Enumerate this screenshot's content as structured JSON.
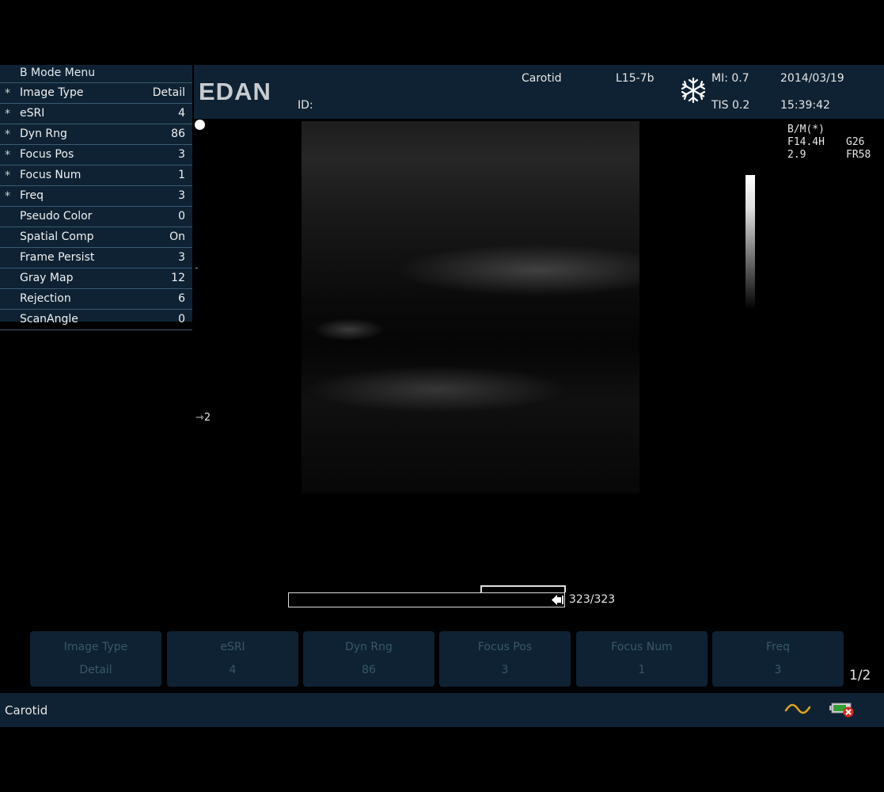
{
  "menu": {
    "title": "B Mode Menu",
    "items": [
      {
        "star": "*",
        "label": "Image Type",
        "value": "Detail"
      },
      {
        "star": "*",
        "label": "eSRI",
        "value": "4"
      },
      {
        "star": "*",
        "label": "Dyn Rng",
        "value": "86"
      },
      {
        "star": "*",
        "label": "Focus Pos",
        "value": "3"
      },
      {
        "star": "*",
        "label": "Focus Num",
        "value": "1"
      },
      {
        "star": "*",
        "label": "Freq",
        "value": "3"
      },
      {
        "star": "",
        "label": "Pseudo Color",
        "value": "0"
      },
      {
        "star": "",
        "label": "Spatial Comp",
        "value": "On"
      },
      {
        "star": "",
        "label": "Frame Persist",
        "value": "3"
      },
      {
        "star": "",
        "label": "Gray Map",
        "value": "12"
      },
      {
        "star": "",
        "label": "Rejection",
        "value": "6"
      },
      {
        "star": "",
        "label": "ScanAngle",
        "value": "0"
      }
    ]
  },
  "header": {
    "logo": "EDAN",
    "id_label": "ID:",
    "exam": "Carotid",
    "probe": "L15-7b",
    "mi": "MI: 0.7",
    "tis": "TIS 0.2",
    "date": "2014/03/19",
    "time": "15:39:42",
    "freeze_icon": "snowflake-icon"
  },
  "params": {
    "mode": "B/M(*)",
    "freq": "F14.4H",
    "gain": "G26",
    "depth": "2.9",
    "frame_rate": "FR58"
  },
  "focus_marker": "⇾2",
  "cine": {
    "counter": "323/323"
  },
  "softkeys": [
    {
      "name": "Image Type",
      "value": "Detail"
    },
    {
      "name": "eSRI",
      "value": "4"
    },
    {
      "name": "Dyn Rng",
      "value": "86"
    },
    {
      "name": "Focus Pos",
      "value": "3"
    },
    {
      "name": "Focus Num",
      "value": "1"
    },
    {
      "name": "Freq",
      "value": "3"
    }
  ],
  "page_indicator": "1/2",
  "footer": {
    "exam": "Carotid",
    "status_icons": [
      "ac-power-icon",
      "battery-error-icon"
    ]
  },
  "colors": {
    "panel": "#0e2233",
    "divider": "#3a5a72",
    "softkey_text": "#3a5868"
  }
}
